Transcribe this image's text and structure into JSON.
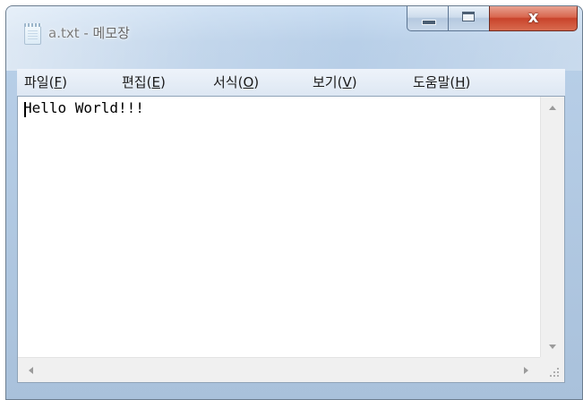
{
  "window": {
    "title": "a.txt - 메모장",
    "icon": "notepad-icon"
  },
  "caption_buttons": {
    "minimize_icon": "minimize-icon",
    "maximize_icon": "maximize-icon",
    "close_glyph": "x",
    "close_color": "#c9432b"
  },
  "menu": {
    "items": [
      {
        "label": "파일(",
        "mnemonic": "F",
        "suffix": ")"
      },
      {
        "label": "편집(",
        "mnemonic": "E",
        "suffix": ")"
      },
      {
        "label": "서식(",
        "mnemonic": "O",
        "suffix": ")"
      },
      {
        "label": "보기(",
        "mnemonic": "V",
        "suffix": ")"
      },
      {
        "label": "도움말(",
        "mnemonic": "H",
        "suffix": ")"
      }
    ]
  },
  "editor": {
    "content": "Hello World!!!"
  },
  "scrollbars": {
    "vertical_up_icon": "arrow-up-icon",
    "vertical_down_icon": "arrow-down-icon",
    "horizontal_left_icon": "arrow-left-icon",
    "horizontal_right_icon": "arrow-right-icon",
    "size_grip_icon": "size-grip-icon"
  }
}
